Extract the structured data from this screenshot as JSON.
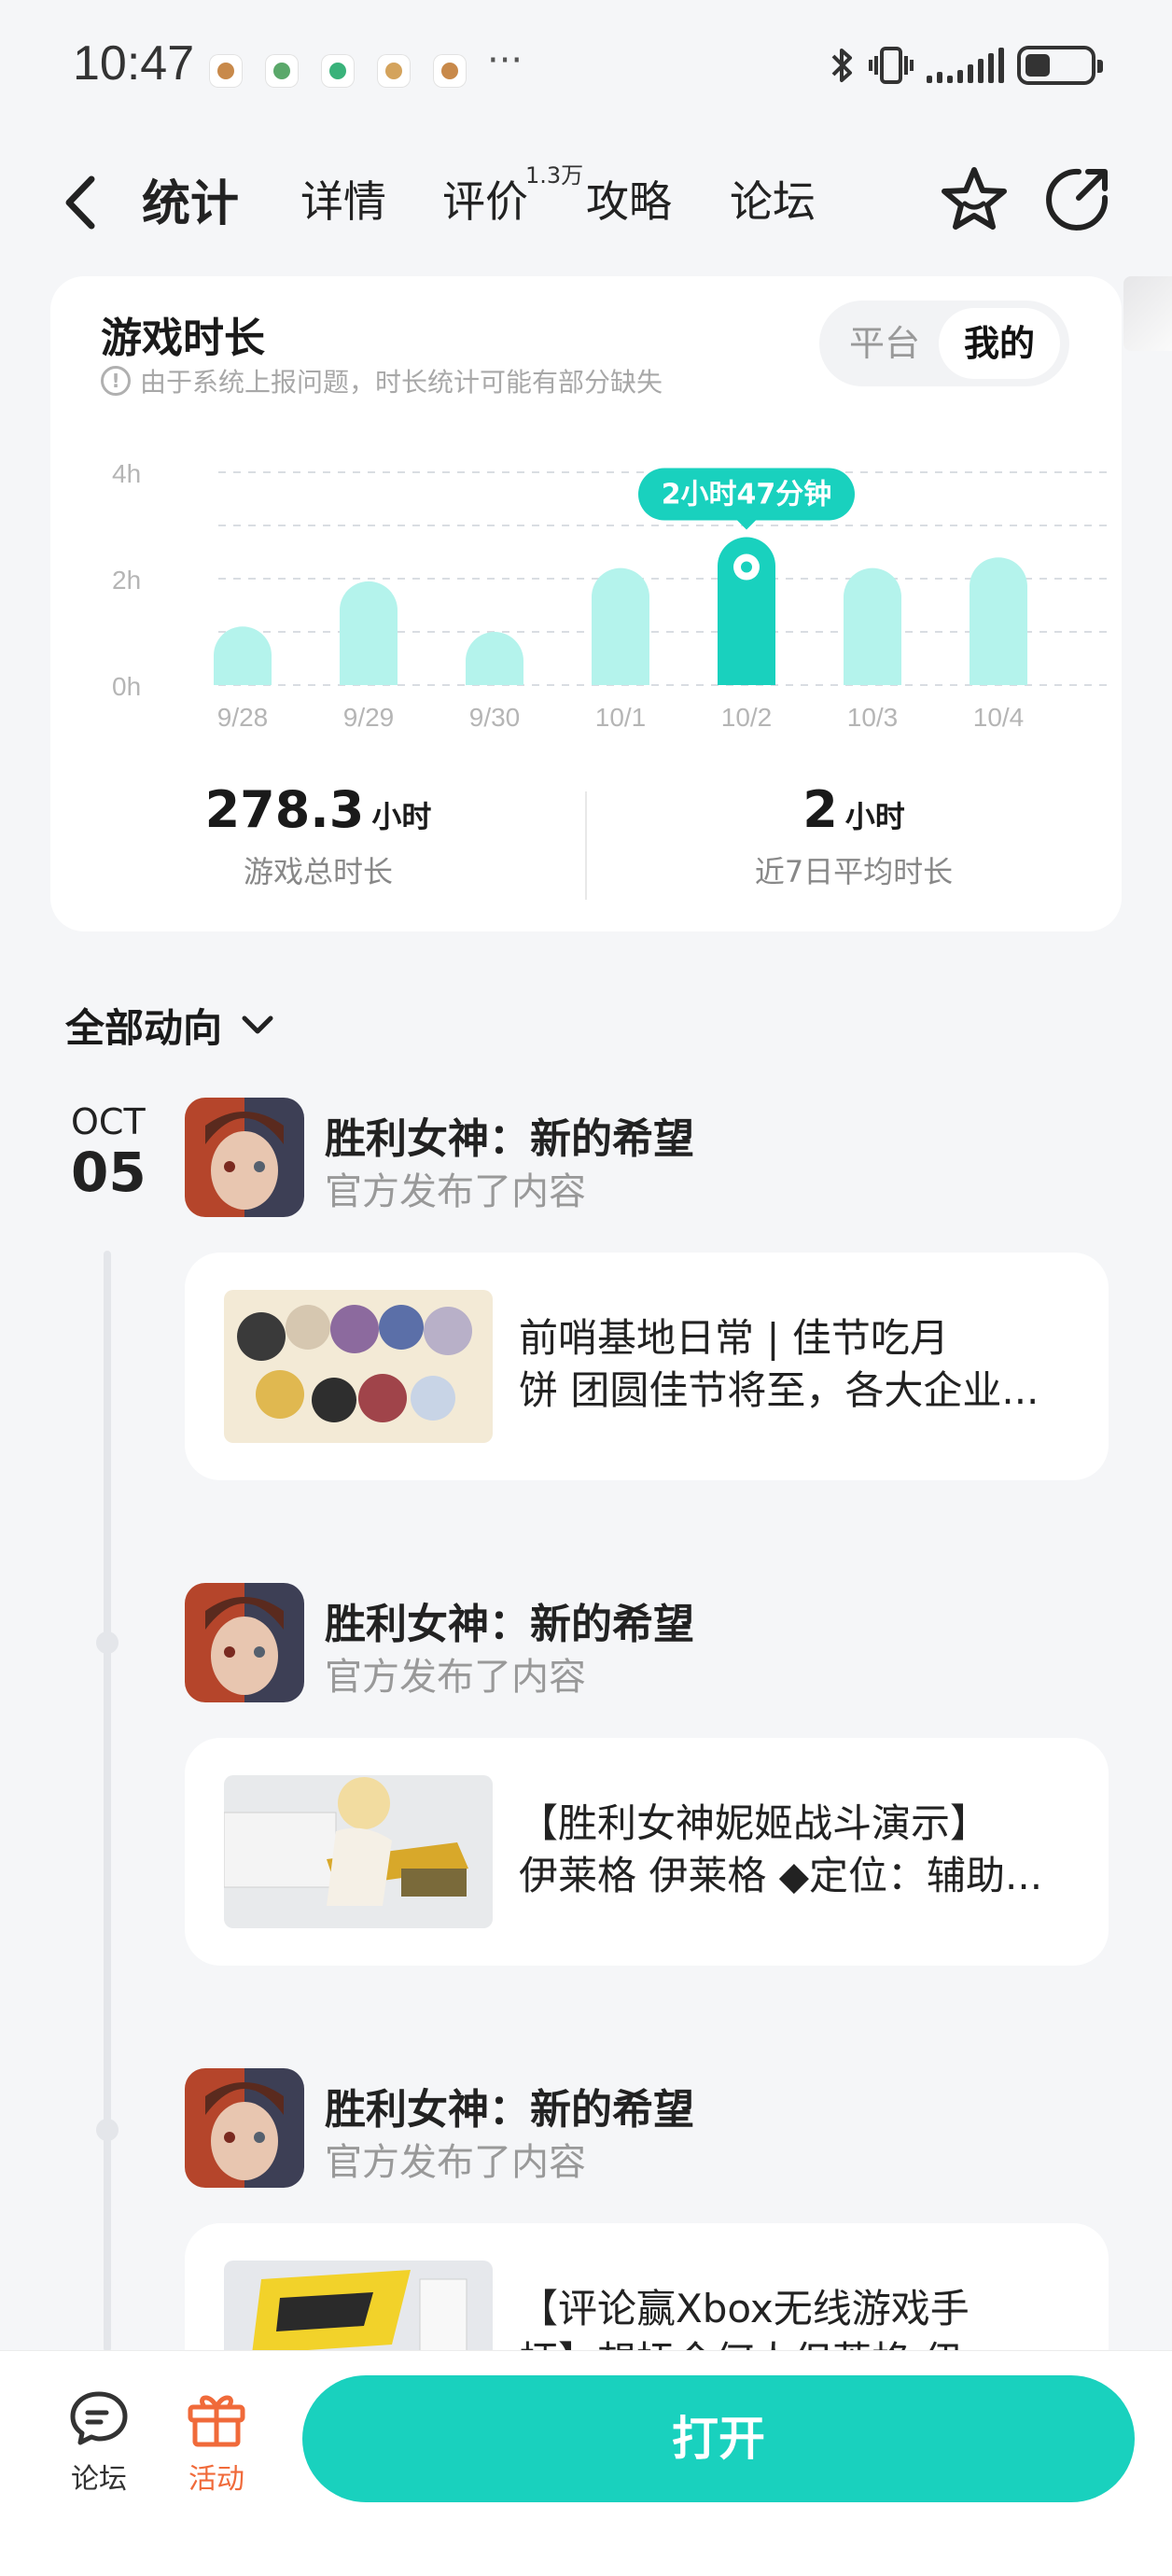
{
  "status_bar": {
    "time": "10:47",
    "more": "···"
  },
  "nav": {
    "tabs": [
      {
        "label": "统计"
      },
      {
        "label": "详情"
      },
      {
        "label": "评价"
      },
      {
        "label": "攻略"
      },
      {
        "label": "论坛"
      }
    ],
    "review_count": "1.3万",
    "active_tab": "统计"
  },
  "stats_card": {
    "title": "游戏时长",
    "hint": "由于系统上报问题，时长统计可能有部分缺失",
    "segment": {
      "option_platform": "平台",
      "option_mine": "我的",
      "selected": "我的"
    },
    "total": {
      "value": "278.3",
      "unit": "小时",
      "label": "游戏总时长"
    },
    "average": {
      "value": "2",
      "unit": "小时",
      "label": "近7日平均时长"
    }
  },
  "chart_data": {
    "type": "bar",
    "categories": [
      "9/28",
      "9/29",
      "9/30",
      "10/1",
      "10/2",
      "10/3",
      "10/4"
    ],
    "values": [
      1.1,
      1.95,
      1.0,
      2.2,
      2.78,
      2.2,
      2.4
    ],
    "y_ticks": [
      "4h",
      "2h",
      "0h"
    ],
    "ylim": [
      0,
      4
    ],
    "grid": true,
    "highlighted": {
      "category": "10/2",
      "label": "2小时47分钟"
    },
    "colors": {
      "bar": "#b4f3ec",
      "highlight": "#19d1be"
    }
  },
  "feed": {
    "filter_label": "全部动向",
    "date": {
      "month": "OCT",
      "day": "05"
    },
    "posts": [
      {
        "game": "胜利女神：新的希望",
        "action": "官方发布了内容",
        "line1": "前哨基地日常 | 佳节吃月",
        "line2": "饼 团圆佳节将至，各大企业..."
      },
      {
        "game": "胜利女神：新的希望",
        "action": "官方发布了内容",
        "line1": "【胜利女神妮姬战斗演示】",
        "line2": "伊莱格 伊莱格 ◆定位：辅助..."
      },
      {
        "game": "胜利女神：新的希望",
        "action": "官方发布了内容",
        "line1": "【评论赢Xbox无线游戏手",
        "line2": "柄】想抚今何人但莱格 伊..."
      }
    ]
  },
  "bottom_bar": {
    "forum_label": "论坛",
    "activity_label": "活动",
    "open_button": "打开",
    "colors": {
      "accent": "#19d1be",
      "activity": "#f06a3a"
    }
  }
}
